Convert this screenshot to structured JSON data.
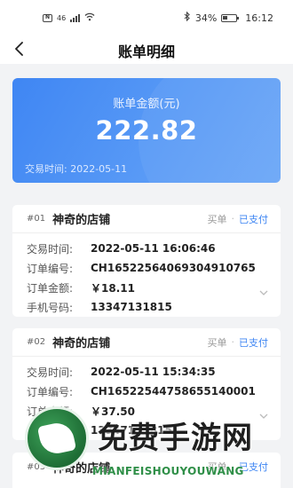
{
  "status_bar": {
    "battery": "34%",
    "time": "16:12",
    "network": "46"
  },
  "nav": {
    "title": "账单明细"
  },
  "summary": {
    "label": "账单金额(元)",
    "amount": "222.82",
    "date": "交易时间: 2022-05-11"
  },
  "orders": [
    {
      "no": "#01",
      "shop": "神奇的店铺",
      "type": "买单",
      "status": "已支付",
      "rows": [
        {
          "label": "交易时间:",
          "value": "2022-05-11 16:06:46"
        },
        {
          "label": "订单编号:",
          "value": "CH16522564069304910765"
        },
        {
          "label": "订单金额:",
          "value": "￥18.11"
        },
        {
          "label": "手机号码:",
          "value": "13347131815"
        }
      ]
    },
    {
      "no": "#02",
      "shop": "神奇的店铺",
      "type": "买单",
      "status": "已支付",
      "rows": [
        {
          "label": "交易时间:",
          "value": "2022-05-11 15:34:35"
        },
        {
          "label": "订单编号:",
          "value": "CH16522544758655140001"
        },
        {
          "label": "订单金额:",
          "value": "￥37.50"
        },
        {
          "label": "手机号码:",
          "value": "13347131815"
        }
      ]
    },
    {
      "no": "#03",
      "shop": "神奇的店铺",
      "type": "买单",
      "status": "已支付",
      "rows": []
    }
  ],
  "watermark": {
    "title": "免费手游网",
    "subtitle": "MIANFEISHOUYOUWANG"
  },
  "colors": {
    "accent": "#3f86f3",
    "background": "#f2f3f5"
  }
}
